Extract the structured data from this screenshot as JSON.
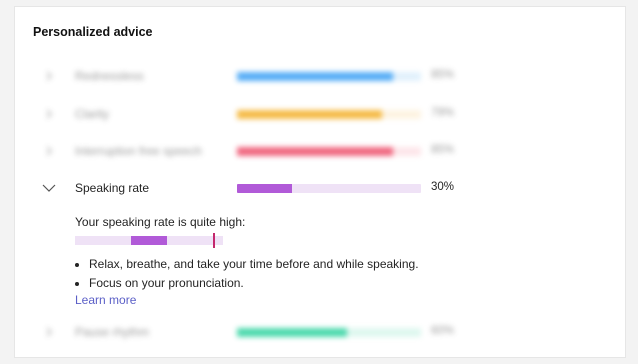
{
  "panel": {
    "title": "Personalized advice"
  },
  "metrics": [
    {
      "label": "Rednessless",
      "value": 85,
      "value_text": "85%",
      "track": "#dbeefc",
      "fill": "#3aa0f5"
    },
    {
      "label": "Clarity",
      "value": 79,
      "value_text": "79%",
      "track": "#fdf1dc",
      "fill": "#f4b028"
    },
    {
      "label": "Interruption free speech",
      "value": 85,
      "value_text": "85%",
      "track": "#fde1e6",
      "fill": "#ee4d6a"
    },
    {
      "label": "Speaking rate",
      "value": 30,
      "value_text": "30%",
      "track": "#efe2f6",
      "fill": "#b15ad8"
    },
    {
      "label": "Pause rhythm",
      "value": 60,
      "value_text": "60%",
      "track": "#d8f6ec",
      "fill": "#2fd3a0"
    }
  ],
  "detail": {
    "heading": "Your speaking rate is quite high:",
    "scale_colors": {
      "track": "#efe2f6",
      "range": "#b15ad8",
      "marker": "#c4286d"
    },
    "tips": [
      "Relax, breathe, and take your time before and while speaking.",
      "Focus on your pronunciation."
    ],
    "link_label": "Learn more"
  },
  "icons": {
    "collapsed": "chevron-right-icon",
    "expanded": "chevron-down-icon"
  }
}
